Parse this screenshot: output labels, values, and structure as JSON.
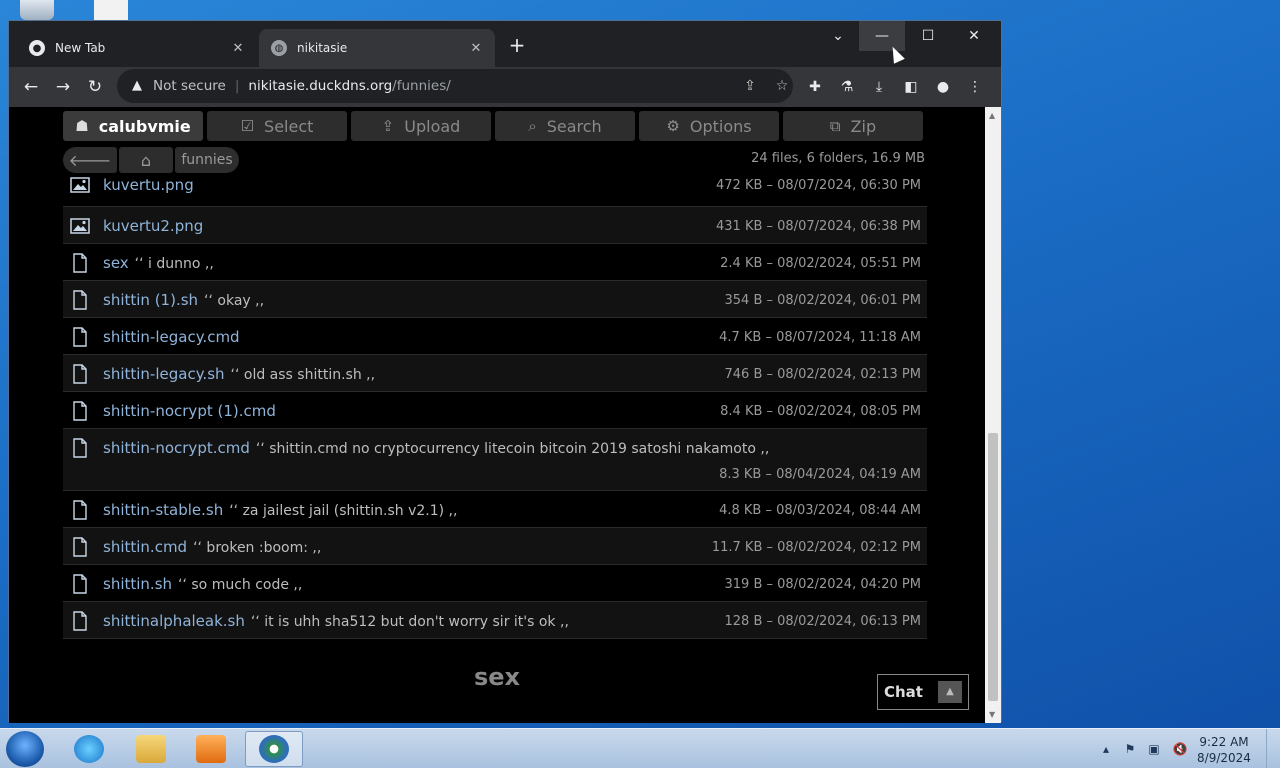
{
  "browser": {
    "tabs": [
      {
        "title": "New Tab",
        "active": false
      },
      {
        "title": "nikitasie",
        "active": true
      }
    ],
    "address": {
      "security": "Not secure",
      "host": "nikitasie.duckdns.org",
      "path": "/funnies/"
    }
  },
  "page": {
    "ops": [
      {
        "label": "calubvmie",
        "icon": "user-icon"
      },
      {
        "label": "Select",
        "icon": "checkbox-icon"
      },
      {
        "label": "Upload",
        "icon": "upload-icon"
      },
      {
        "label": "Search",
        "icon": "search-icon"
      },
      {
        "label": "Options",
        "icon": "gear-icon"
      },
      {
        "label": "Zip",
        "icon": "zip-icon"
      }
    ],
    "breadcrumb": {
      "folder": "funnies"
    },
    "summary": "24 files, 6 folders, 16.9 MB",
    "files": [
      {
        "name": "kuvertu.png",
        "comment": "",
        "meta": "472 KB – 08/07/2024, 06:30 PM",
        "icon": "image-icon"
      },
      {
        "name": "kuvertu2.png",
        "comment": "",
        "meta": "431 KB – 08/07/2024, 06:38 PM",
        "icon": "image-icon"
      },
      {
        "name": "sex",
        "comment": "‘‘ i dunno ,,",
        "meta": "2.4 KB – 08/02/2024, 05:51 PM",
        "icon": "file-icon"
      },
      {
        "name": "shittin (1).sh",
        "comment": "‘‘ okay ,,",
        "meta": "354 B – 08/02/2024, 06:01 PM",
        "icon": "file-icon"
      },
      {
        "name": "shittin-legacy.cmd",
        "comment": "",
        "meta": "4.7 KB – 08/07/2024, 11:18 AM",
        "icon": "file-icon"
      },
      {
        "name": "shittin-legacy.sh",
        "comment": "‘‘ old ass shittin.sh ,,",
        "meta": "746 B – 08/02/2024, 02:13 PM",
        "icon": "file-icon"
      },
      {
        "name": "shittin-nocrypt (1).cmd",
        "comment": "",
        "meta": "8.4 KB – 08/02/2024, 08:05 PM",
        "icon": "file-icon"
      },
      {
        "name": "shittin-nocrypt.cmd",
        "comment": "‘‘ shittin.cmd no cryptocurrency litecoin bitcoin 2019 satoshi nakamoto ,,",
        "meta": "8.3 KB – 08/04/2024, 04:19 AM",
        "icon": "file-icon"
      },
      {
        "name": "shittin-stable.sh",
        "comment": "‘‘ za jailest jail (shittin.sh v2.1) ,,",
        "meta": "4.8 KB – 08/03/2024, 08:44 AM",
        "icon": "file-icon"
      },
      {
        "name": "shittin.cmd",
        "comment": "‘‘ broken :boom: ,,",
        "meta": "11.7 KB – 08/02/2024, 02:12 PM",
        "icon": "file-icon"
      },
      {
        "name": "shittin.sh",
        "comment": "‘‘ so much code ,,",
        "meta": "319 B – 08/02/2024, 04:20 PM",
        "icon": "file-icon"
      },
      {
        "name": "shittinalphaleak.sh",
        "comment": "‘‘ it is uhh sha512 but don't worry sir it's ok ,,",
        "meta": "128 B – 08/02/2024, 06:13 PM",
        "icon": "file-icon"
      }
    ],
    "footer_title": "sex",
    "chat_label": "Chat"
  },
  "taskbar": {
    "time": "9:22 AM",
    "date": "8/9/2024"
  },
  "colors": {
    "link": "#8fb3d9",
    "page_bg": "#000000",
    "button_bg": "#2d2d2d"
  }
}
